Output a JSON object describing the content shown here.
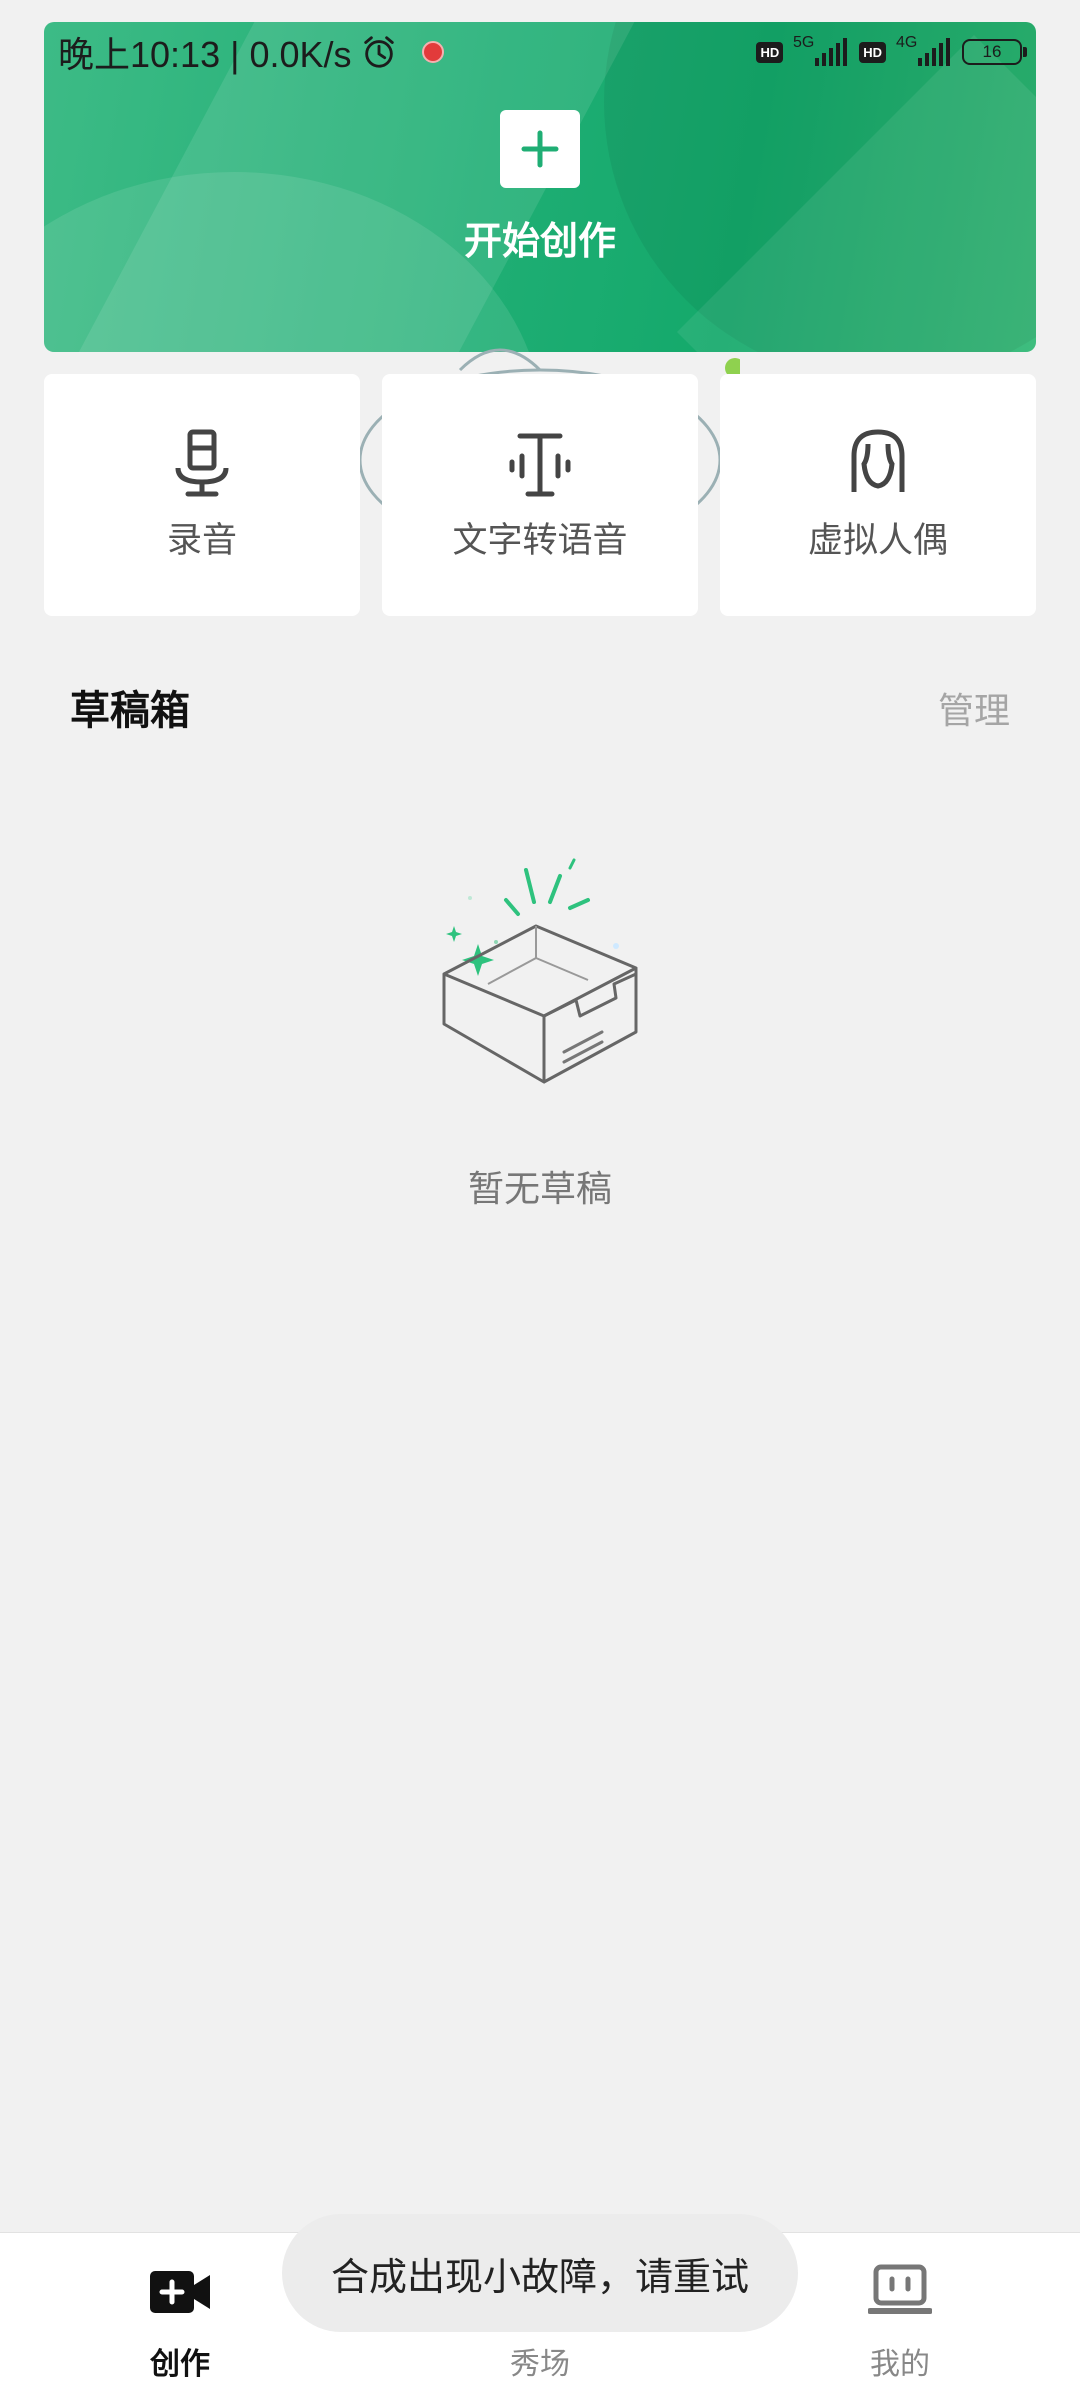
{
  "status_bar": {
    "time_speed": "晚上10:13 | 0.0K/s",
    "hd_badge": "HD",
    "network_1": "5G",
    "network_2": "4G",
    "battery": "16"
  },
  "hero": {
    "create_label": "开始创作",
    "accent_color": "#1fae74"
  },
  "features": [
    {
      "label": "录音",
      "icon": "microphone-icon"
    },
    {
      "label": "文字转语音",
      "icon": "text-to-speech-icon"
    },
    {
      "label": "虚拟人偶",
      "icon": "avatar-icon"
    }
  ],
  "drafts": {
    "title": "草稿箱",
    "manage": "管理",
    "empty_text": "暂无草稿"
  },
  "bottom_nav": [
    {
      "label": "创作",
      "icon": "video-camera-plus-icon",
      "active": true
    },
    {
      "label": "秀场",
      "icon": "stage-icon",
      "active": false
    },
    {
      "label": "我的",
      "icon": "computer-icon",
      "active": false
    }
  ],
  "toast": {
    "message": "合成出现小故障，请重试"
  }
}
